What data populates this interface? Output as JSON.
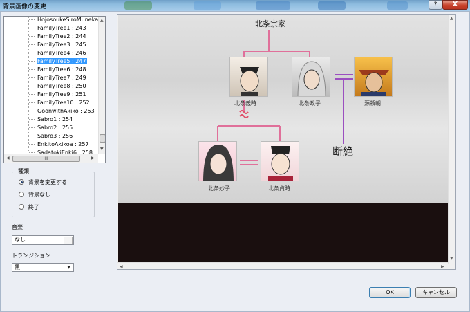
{
  "window": {
    "title": "背景画像の変更",
    "help_label": "?",
    "close_label": "X"
  },
  "tree": {
    "items": [
      "HojosoukeSiroMunekata",
      "FamilyTree1 : 243",
      "FamilyTree2 : 244",
      "FamilyTree3 : 245",
      "FamilyTree4 : 246",
      "FamilyTree5 : 247",
      "FamilyTree6 : 248",
      "FamilyTree7 : 249",
      "FamilyTree8 : 250",
      "FamilyTree9 : 251",
      "FamilyTree10 : 252",
      "GoonwithAkiko : 253",
      "Sabro1 : 254",
      "Sabro2 : 255",
      "Sabro3 : 256",
      "EnkitoAkikoa : 257",
      "SadatokiEnki6 : 258"
    ],
    "selected": "FamilyTree5 : 247",
    "hscroll_grip": "III"
  },
  "mode_group": {
    "title": "種類",
    "options": [
      "背景を変更する",
      "背景なし",
      "終了"
    ],
    "selected": "背景を変更する"
  },
  "music": {
    "label": "音楽",
    "value": "なし",
    "browse_label": "..."
  },
  "transition": {
    "label": "トランジション",
    "value": "黒"
  },
  "preview": {
    "clan_title": "北条宗家",
    "people": {
      "yoshitoki": "北条義時",
      "masako": "北条政子",
      "yoritomo": "源頼朝",
      "myoko": "北条妙子",
      "sadatoki": "北条貞時"
    },
    "extinct_label": "断絶",
    "colors": {
      "line_pink": "#e0709a",
      "line_purple": "#9b4fc0",
      "line_red": "#e0506a"
    }
  },
  "buttons": {
    "ok": "OK",
    "cancel": "キャンセル"
  }
}
